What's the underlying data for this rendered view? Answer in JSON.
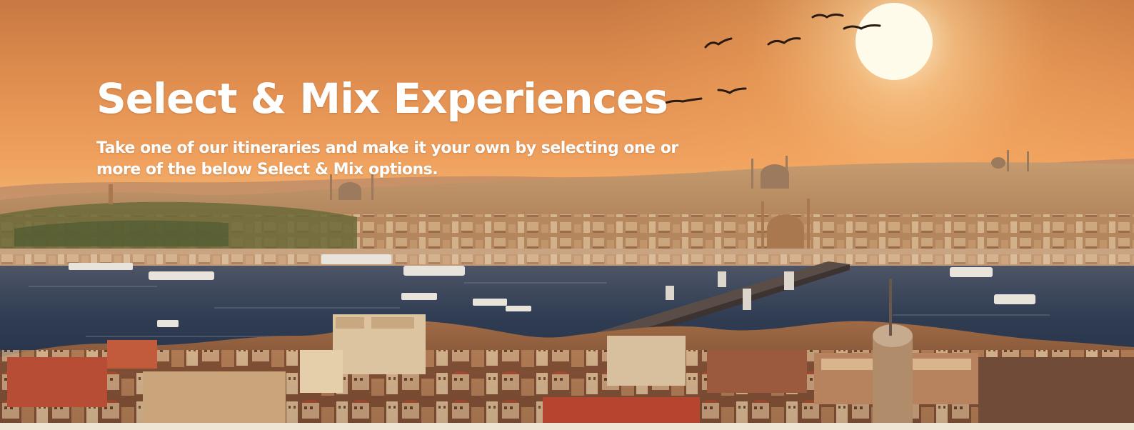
{
  "hero": {
    "title": "Select & Mix Experiences",
    "subtitle": "Take one of our itineraries and make it your own by selecting one or more of the below Select & Mix options.",
    "image_description": "sunset-over-istanbul-golden-horn",
    "text_color": "#ffffff",
    "sky_colors": [
      "#c97a3f",
      "#ee9b56",
      "#f3ad66"
    ],
    "water_color": "#34455a",
    "footer_strip_color": "#efe6d6"
  }
}
